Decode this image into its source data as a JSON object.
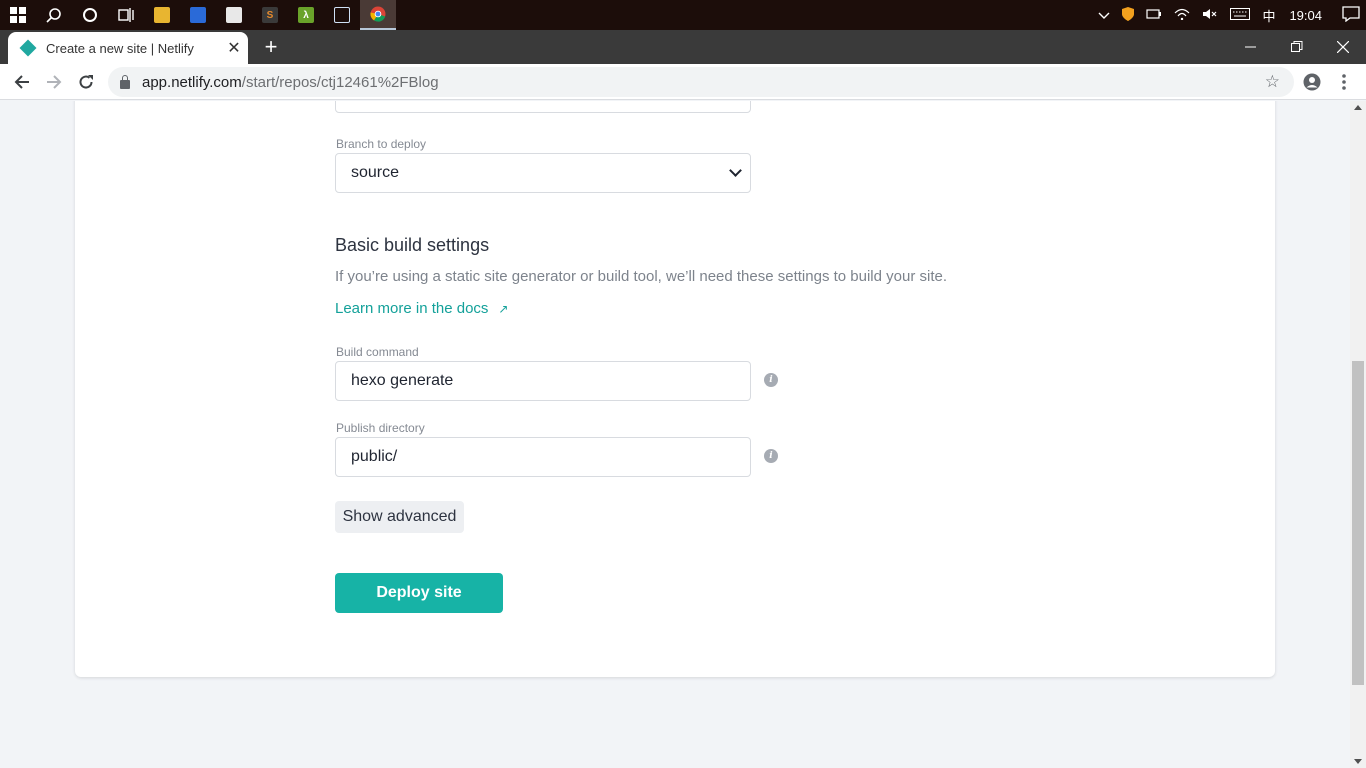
{
  "taskbar": {
    "clock": "19:04",
    "ime": "中",
    "apps": [
      {
        "name": "file-explorer",
        "color": "#e8b530"
      },
      {
        "name": "app-dw",
        "color": "#2a6ad8"
      },
      {
        "name": "app-note",
        "color": "#e8e8e8"
      },
      {
        "name": "sublime-text",
        "color": "#e5892d"
      },
      {
        "name": "lambda-app",
        "color": "#6aa32a"
      },
      {
        "name": "box-app",
        "color": "#3a8ae0"
      },
      {
        "name": "chrome",
        "color": "#db4437"
      }
    ]
  },
  "browser": {
    "tab_title": "Create a new site | Netlify",
    "url_host": "app.netlify.com",
    "url_path": "/start/repos/ctj12461%2FBlog"
  },
  "form": {
    "branch_label": "Branch to deploy",
    "branch_value": "source",
    "section_heading": "Basic build settings",
    "section_desc": "If you’re using a static site generator or build tool, we’ll need these settings to build your site.",
    "docs_link": "Learn more in the docs",
    "docs_arrow": "↗",
    "build_command_label": "Build command",
    "build_command_value": "hexo generate",
    "publish_dir_label": "Publish directory",
    "publish_dir_value": "public/",
    "show_advanced": "Show advanced",
    "deploy_button": "Deploy site"
  },
  "colors": {
    "accent": "#17b3a6",
    "link": "#14a19a"
  }
}
